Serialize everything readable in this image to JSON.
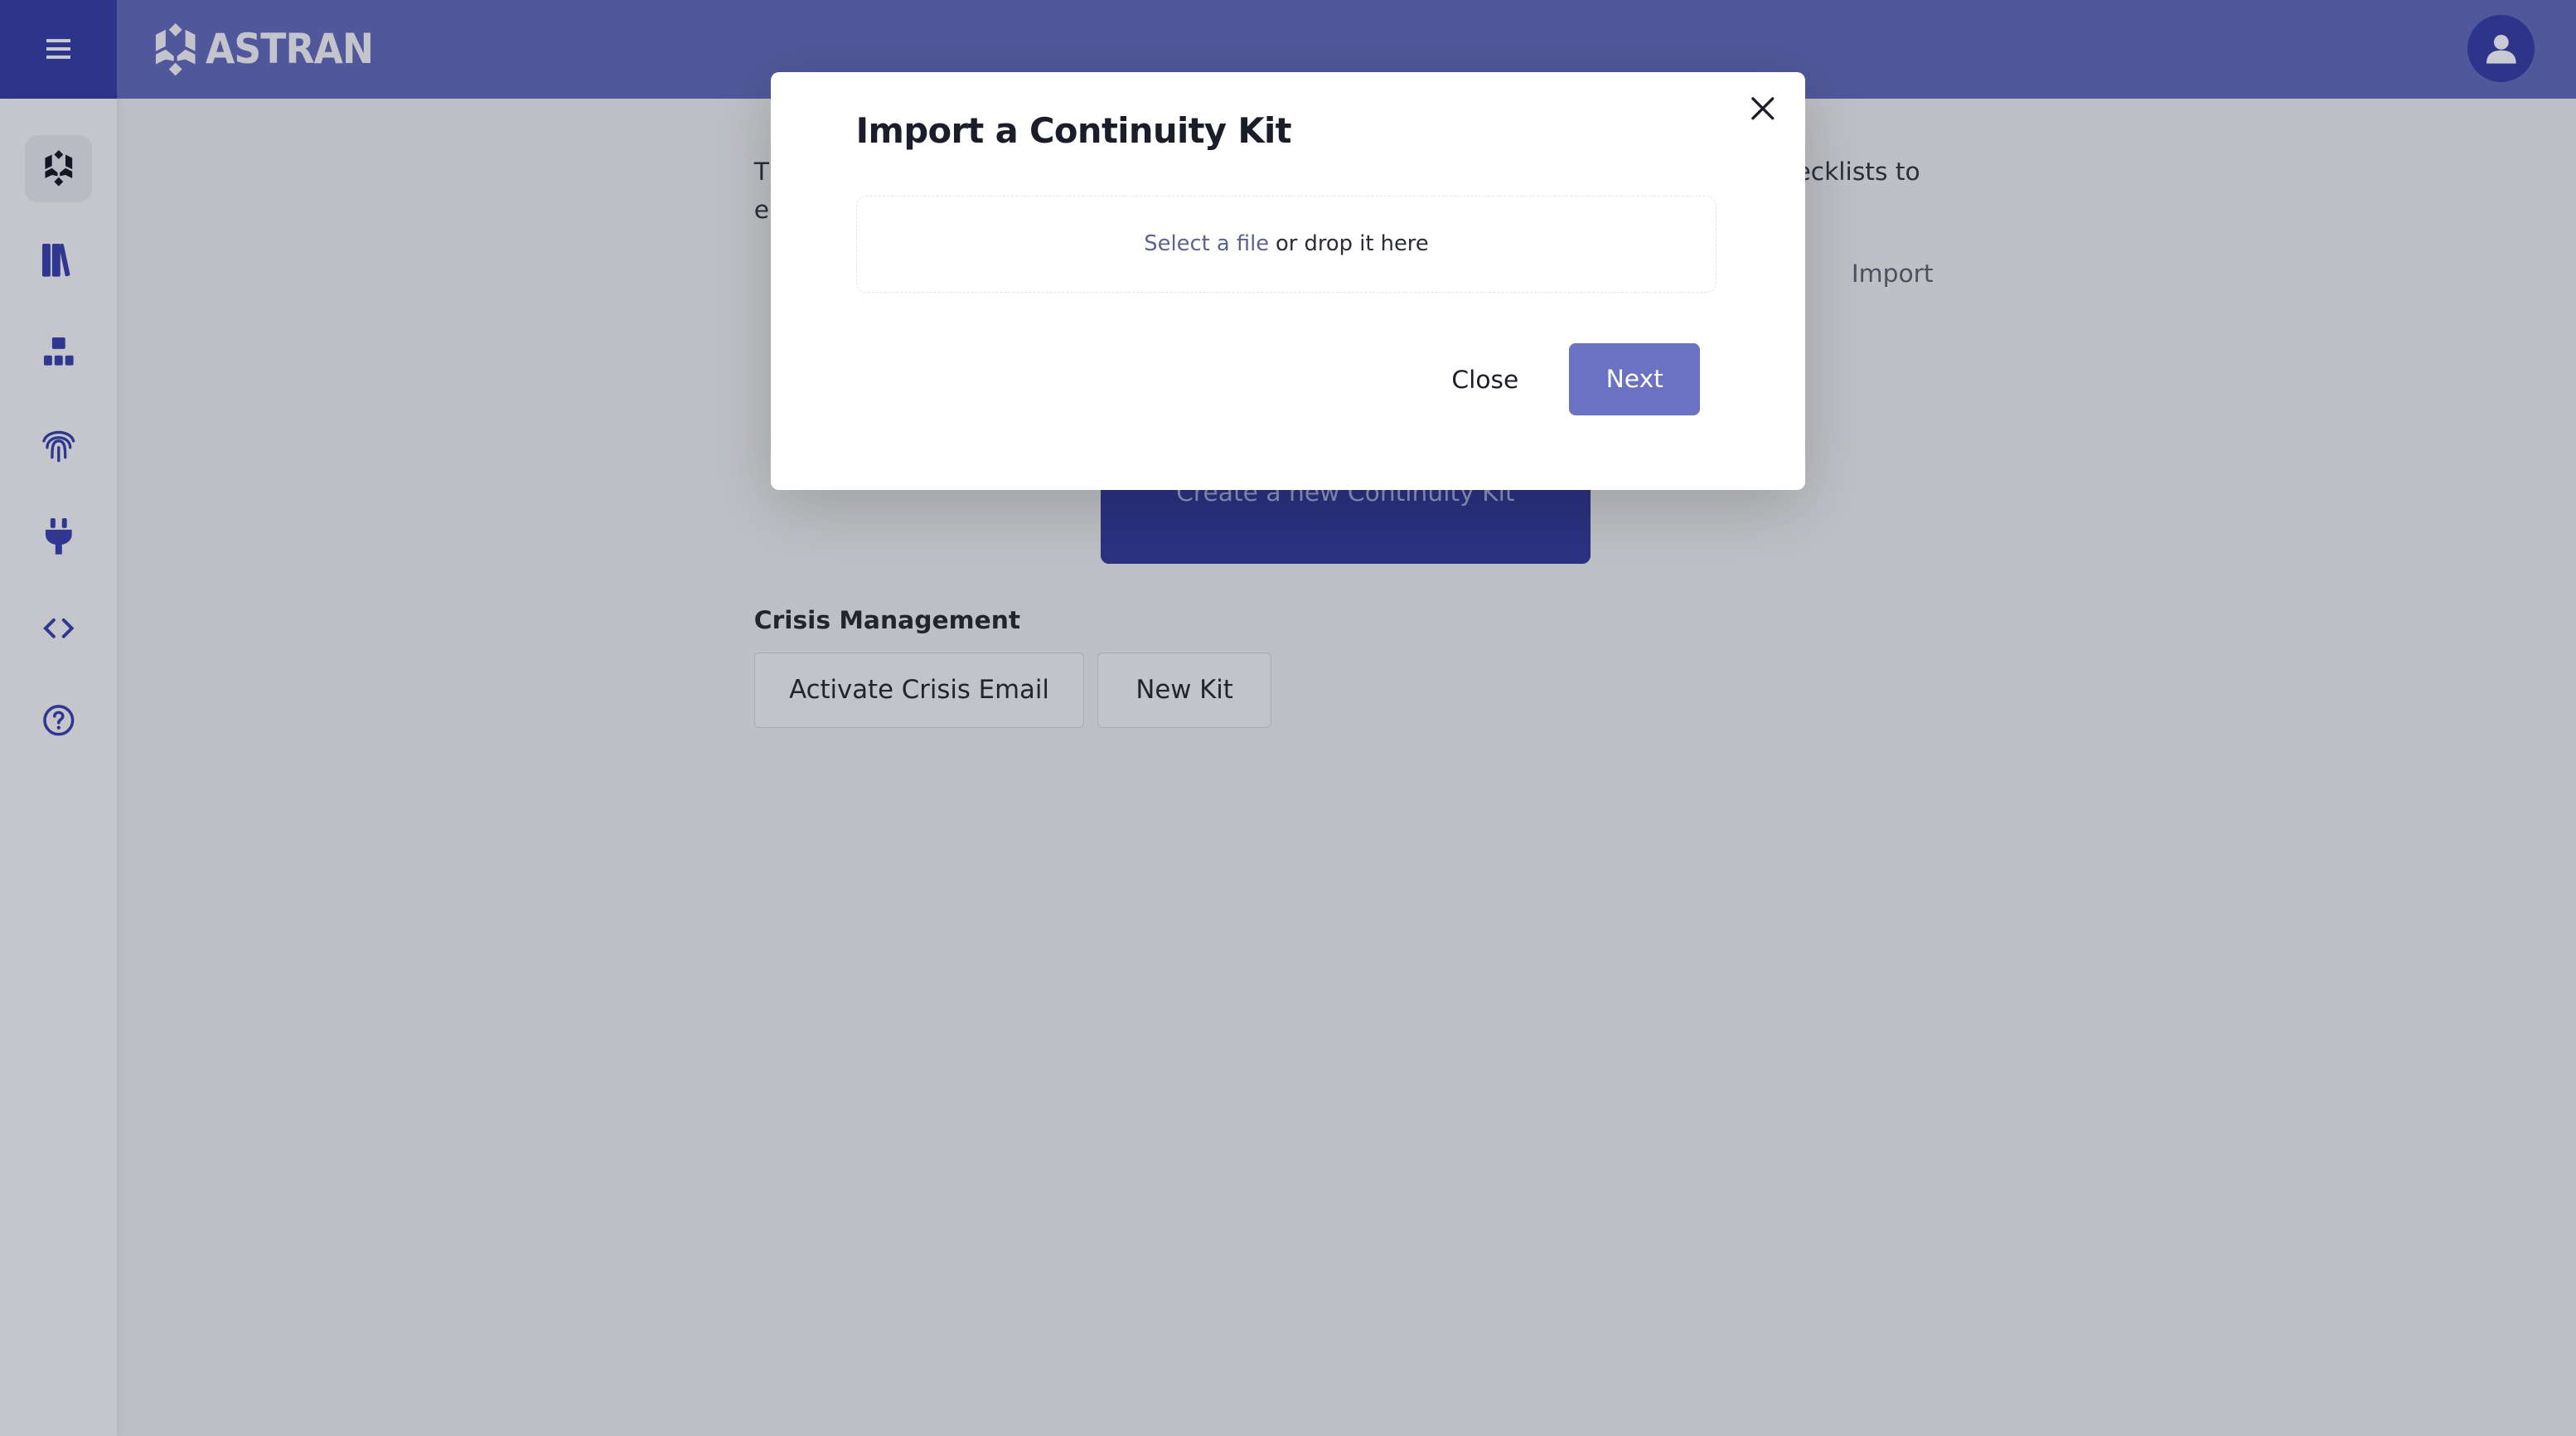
{
  "header": {
    "brand": "ASTRAN",
    "menu_icon": "hamburger-icon",
    "user_icon": "user-icon"
  },
  "colors": {
    "header": "#50589b",
    "menu_button": "#2d358a",
    "primary_button": "#6b72c3",
    "create_button": "#2b3280"
  },
  "sidebar": {
    "items": [
      {
        "icon": "astran-logo-icon",
        "active": true
      },
      {
        "icon": "library-icon"
      },
      {
        "icon": "sitemap-icon"
      },
      {
        "icon": "fingerprint-icon"
      },
      {
        "icon": "plug-icon"
      },
      {
        "icon": "code-icon"
      },
      {
        "icon": "help-icon"
      }
    ]
  },
  "main": {
    "intro_fragment_1": "T",
    "intro_fragment_2": "e",
    "intro_fragment_3": "ecklists to",
    "import_link": "Import",
    "create_button": "Create a new Continuity Kit",
    "crisis_title": "Crisis Management",
    "activate_crisis_email": "Activate Crisis Email",
    "new_kit": "New Kit"
  },
  "modal": {
    "title": "Import a Continuity Kit",
    "dropzone_link": "Select a file",
    "dropzone_text": "or drop it here",
    "close_label": "Close",
    "next_label": "Next"
  }
}
